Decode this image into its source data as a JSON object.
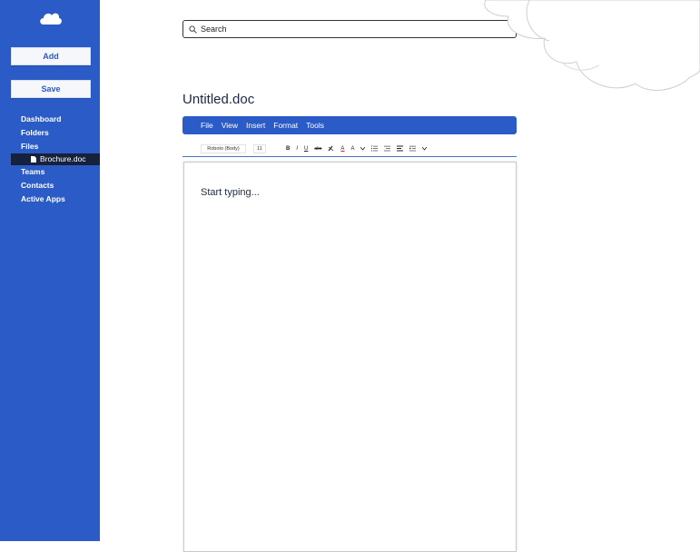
{
  "sidebar": {
    "logo_icon": "cloud-icon",
    "add_label": "Add",
    "save_label": "Save",
    "nav": [
      {
        "label": "Dashboard"
      },
      {
        "label": "Folders"
      },
      {
        "label": "Files"
      },
      {
        "label": "Teams"
      },
      {
        "label": "Contacts"
      },
      {
        "label": "Active Apps"
      }
    ],
    "active_file": {
      "label": "Brochure.doc",
      "icon": "file-icon"
    }
  },
  "search": {
    "placeholder": "Search",
    "value": "",
    "icon": "search-icon"
  },
  "document": {
    "title": "Untitled.doc",
    "menu": [
      "File",
      "View",
      "Insert",
      "Format",
      "Tools"
    ],
    "toolbar": {
      "font": "Roboto (Body)",
      "size": "11",
      "bold": "B",
      "italic": "I",
      "underline": "U",
      "strikethrough": "abc",
      "font_color": "A",
      "highlight": "A"
    },
    "editor_placeholder": "Start typing..."
  },
  "colors": {
    "accent": "#2a5bc6",
    "active_nav": "#16213d"
  }
}
